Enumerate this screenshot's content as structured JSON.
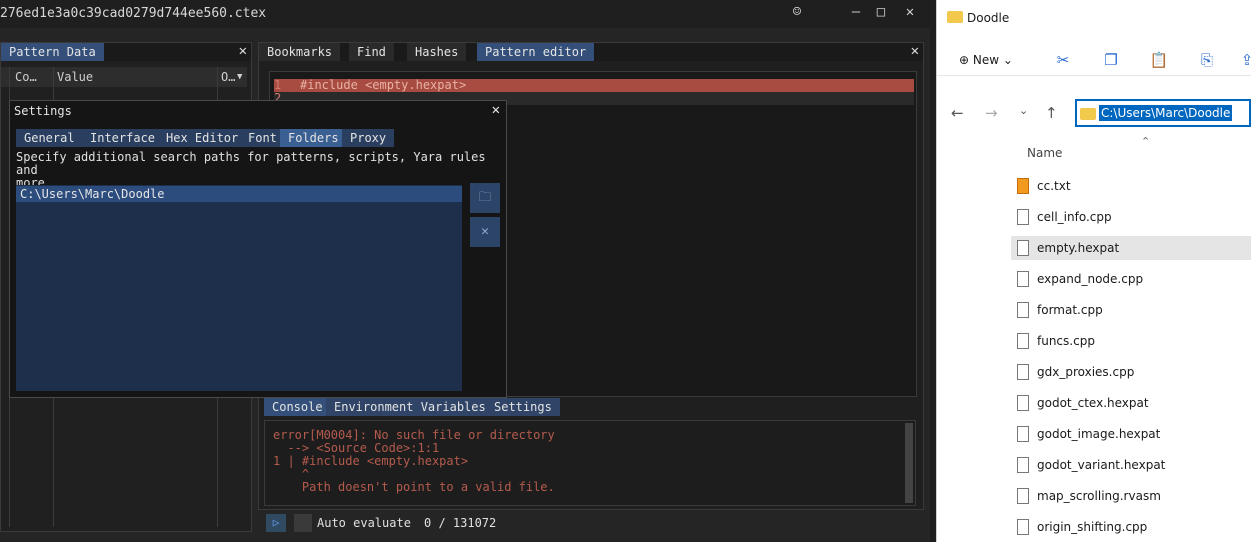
{
  "imhex": {
    "title": "276ed1e3a0c39cad0279d744ee560.ctex",
    "pattern_data": {
      "tab": "Pattern Data",
      "columns": [
        "Co…",
        "Value",
        "O…"
      ]
    },
    "right_tabs": [
      "Bookmarks",
      "Find",
      "Hashes",
      "Pattern editor"
    ],
    "editor_lines": [
      "#include <empty.hexpat>",
      ""
    ],
    "bottom_tabs": [
      "Console",
      "Environment Variables",
      "Settings"
    ],
    "console_lines": [
      "error[M0004]: No such file or directory",
      "  --> <Source Code>:1:1",
      "1 | #include <empty.hexpat>",
      "    ^",
      "    Path doesn't point to a valid file."
    ],
    "status": {
      "auto_evaluate_label": "Auto evaluate",
      "counter": "0 / 131072"
    }
  },
  "settings": {
    "title": "Settings",
    "tabs": [
      "General",
      "Interface",
      "Hex Editor",
      "Font",
      "Folders",
      "Proxy"
    ],
    "active_tab": "Folders",
    "description_line1": "Specify additional search paths for patterns, scripts, Yara rules and",
    "description_line2": "more",
    "paths": [
      "C:\\Users\\Marc\\Doodle"
    ]
  },
  "explorer": {
    "title": "Doodle",
    "new_label": "New",
    "address": "C:\\Users\\Marc\\Doodle",
    "name_header": "Name",
    "files": [
      {
        "name": "cc.txt",
        "icon": "sublime-icon"
      },
      {
        "name": "cell_info.cpp",
        "icon": "file-icon"
      },
      {
        "name": "empty.hexpat",
        "icon": "file-icon",
        "selected": true
      },
      {
        "name": "expand_node.cpp",
        "icon": "file-icon"
      },
      {
        "name": "format.cpp",
        "icon": "file-icon"
      },
      {
        "name": "funcs.cpp",
        "icon": "file-icon"
      },
      {
        "name": "gdx_proxies.cpp",
        "icon": "file-icon"
      },
      {
        "name": "godot_ctex.hexpat",
        "icon": "file-icon"
      },
      {
        "name": "godot_image.hexpat",
        "icon": "file-icon"
      },
      {
        "name": "godot_variant.hexpat",
        "icon": "file-icon"
      },
      {
        "name": "map_scrolling.rvasm",
        "icon": "file-icon"
      },
      {
        "name": "origin_shifting.cpp",
        "icon": "file-icon"
      }
    ]
  }
}
